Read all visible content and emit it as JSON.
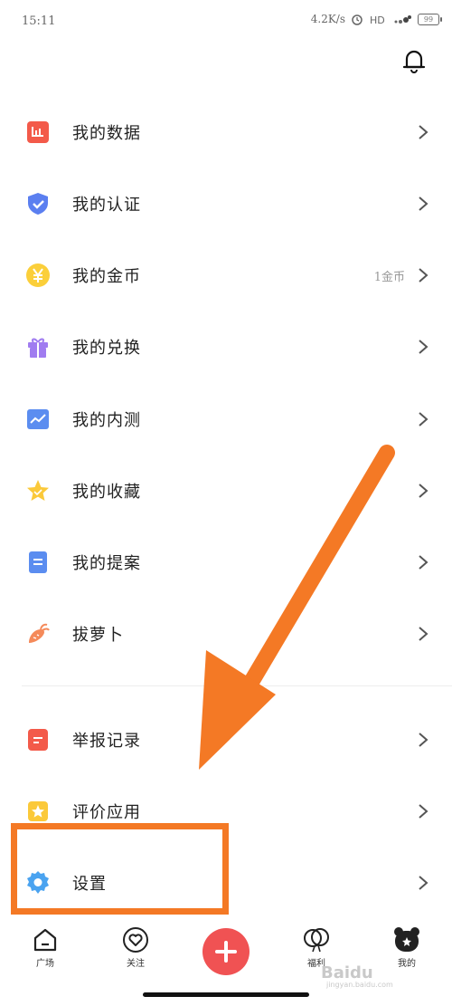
{
  "status_bar": {
    "time": "15:11",
    "speed": "4.2K/s",
    "battery": "99"
  },
  "menu": {
    "items": [
      {
        "label": "我的数据",
        "extra": ""
      },
      {
        "label": "我的认证",
        "extra": ""
      },
      {
        "label": "我的金币",
        "extra": "1金币"
      },
      {
        "label": "我的兑换",
        "extra": ""
      },
      {
        "label": "我的内测",
        "extra": ""
      },
      {
        "label": "我的收藏",
        "extra": ""
      },
      {
        "label": "我的提案",
        "extra": ""
      },
      {
        "label": "拔萝卜",
        "extra": ""
      },
      {
        "label": "举报记录",
        "extra": ""
      },
      {
        "label": "评价应用",
        "extra": ""
      },
      {
        "label": "设置",
        "extra": ""
      }
    ]
  },
  "tabbar": {
    "tabs": [
      {
        "label": "广场"
      },
      {
        "label": "关注"
      },
      {
        "label": "福利"
      },
      {
        "label": "我的"
      }
    ]
  },
  "watermark": {
    "main": "Baidu",
    "sub": "jingyan.baidu.com"
  },
  "colors": {
    "highlight": "#f47925",
    "accent_red": "#f05253",
    "chevron": "#555555"
  }
}
